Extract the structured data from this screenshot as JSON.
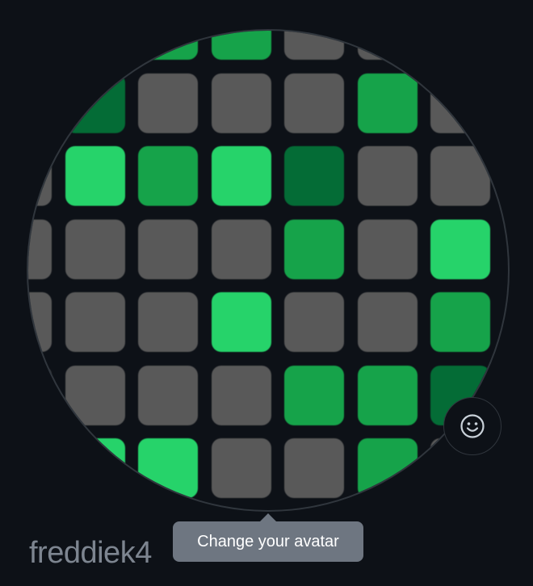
{
  "profile": {
    "username": "freddiek4"
  },
  "avatar": {
    "pattern_colors": {
      "gray": "#595959",
      "green_light": "#26d36a",
      "green_mid": "#16a34a",
      "green_dark": "#046c36"
    },
    "grid": [
      [
        "gray",
        "gray",
        "green_mid",
        "green_mid",
        "gray",
        "gray",
        "gray"
      ],
      [
        "gray",
        "green_dark",
        "gray",
        "gray",
        "gray",
        "green_mid",
        "gray"
      ],
      [
        "gray",
        "green_light",
        "green_mid",
        "green_light",
        "green_dark",
        "gray",
        "gray"
      ],
      [
        "gray",
        "gray",
        "gray",
        "gray",
        "green_mid",
        "gray",
        "green_light"
      ],
      [
        "gray",
        "gray",
        "gray",
        "green_light",
        "gray",
        "gray",
        "green_mid"
      ],
      [
        "gray",
        "gray",
        "gray",
        "gray",
        "green_mid",
        "green_mid",
        "green_dark"
      ],
      [
        "gray",
        "green_light",
        "green_light",
        "gray",
        "gray",
        "green_mid",
        "gray"
      ]
    ]
  },
  "emoji_button": {
    "icon": "smiley-icon"
  },
  "tooltip": {
    "text": "Change your avatar"
  },
  "colors": {
    "background": "#0d1117",
    "border": "#30363d",
    "tooltip_bg": "#6e7681",
    "username": "#7d8590"
  }
}
